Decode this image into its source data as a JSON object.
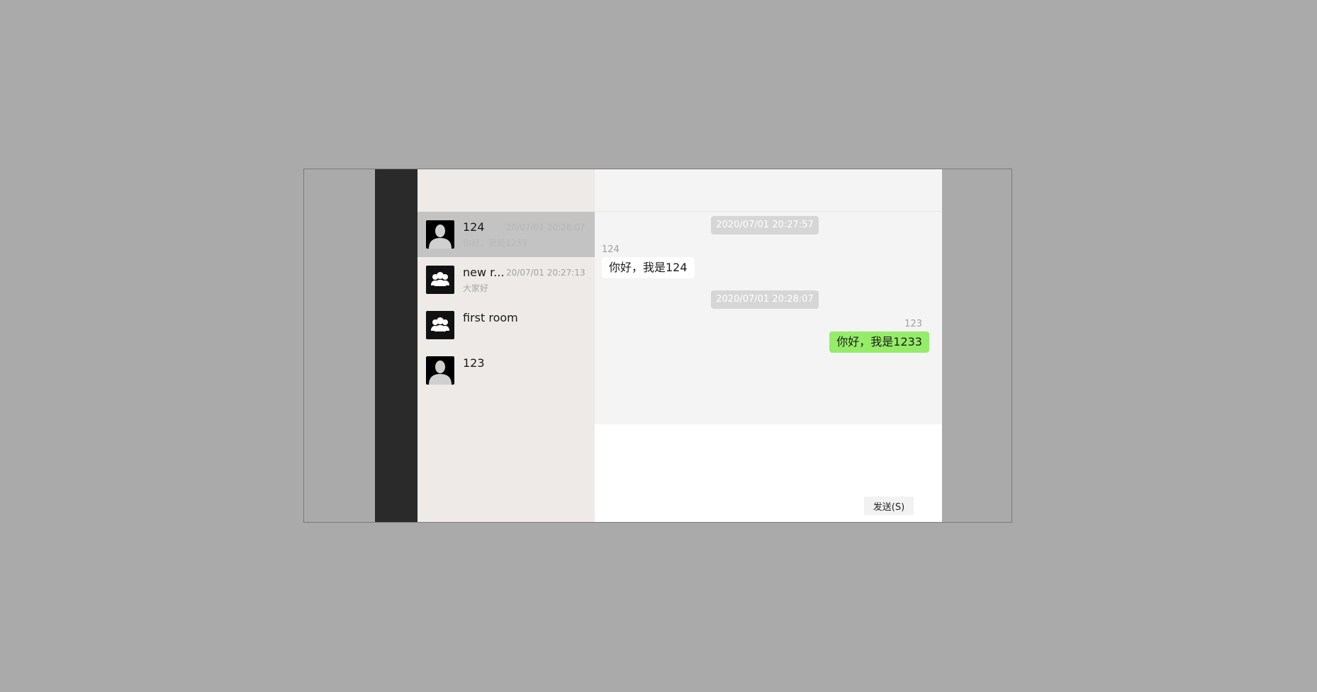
{
  "conversations": [
    {
      "name": "124",
      "time": "20/07/01 20:28:07",
      "preview": "你好，我是1233",
      "type": "user",
      "active": true
    },
    {
      "name": "new r...",
      "time": "20/07/01 20:27:13",
      "preview": "大家好",
      "type": "group",
      "active": false
    },
    {
      "name": "first room",
      "time": "",
      "preview": "",
      "type": "group",
      "active": false
    },
    {
      "name": "123",
      "time": "",
      "preview": "",
      "type": "user",
      "active": false
    }
  ],
  "messages": {
    "time_1": "2020/07/01 20:27:57",
    "msg_1_sender": "124",
    "msg_1_text": "你好，我是124",
    "time_2": "2020/07/01 20:28:07",
    "msg_2_sender": "123",
    "msg_2_text": "你好，我是1233"
  },
  "input": {
    "send_label": "发送(S)"
  },
  "colors": {
    "nav_bg": "#2a2a2a",
    "list_bg": "#edeae7",
    "active_item": "#c3c3c3",
    "own_bubble": "#95ec69"
  }
}
